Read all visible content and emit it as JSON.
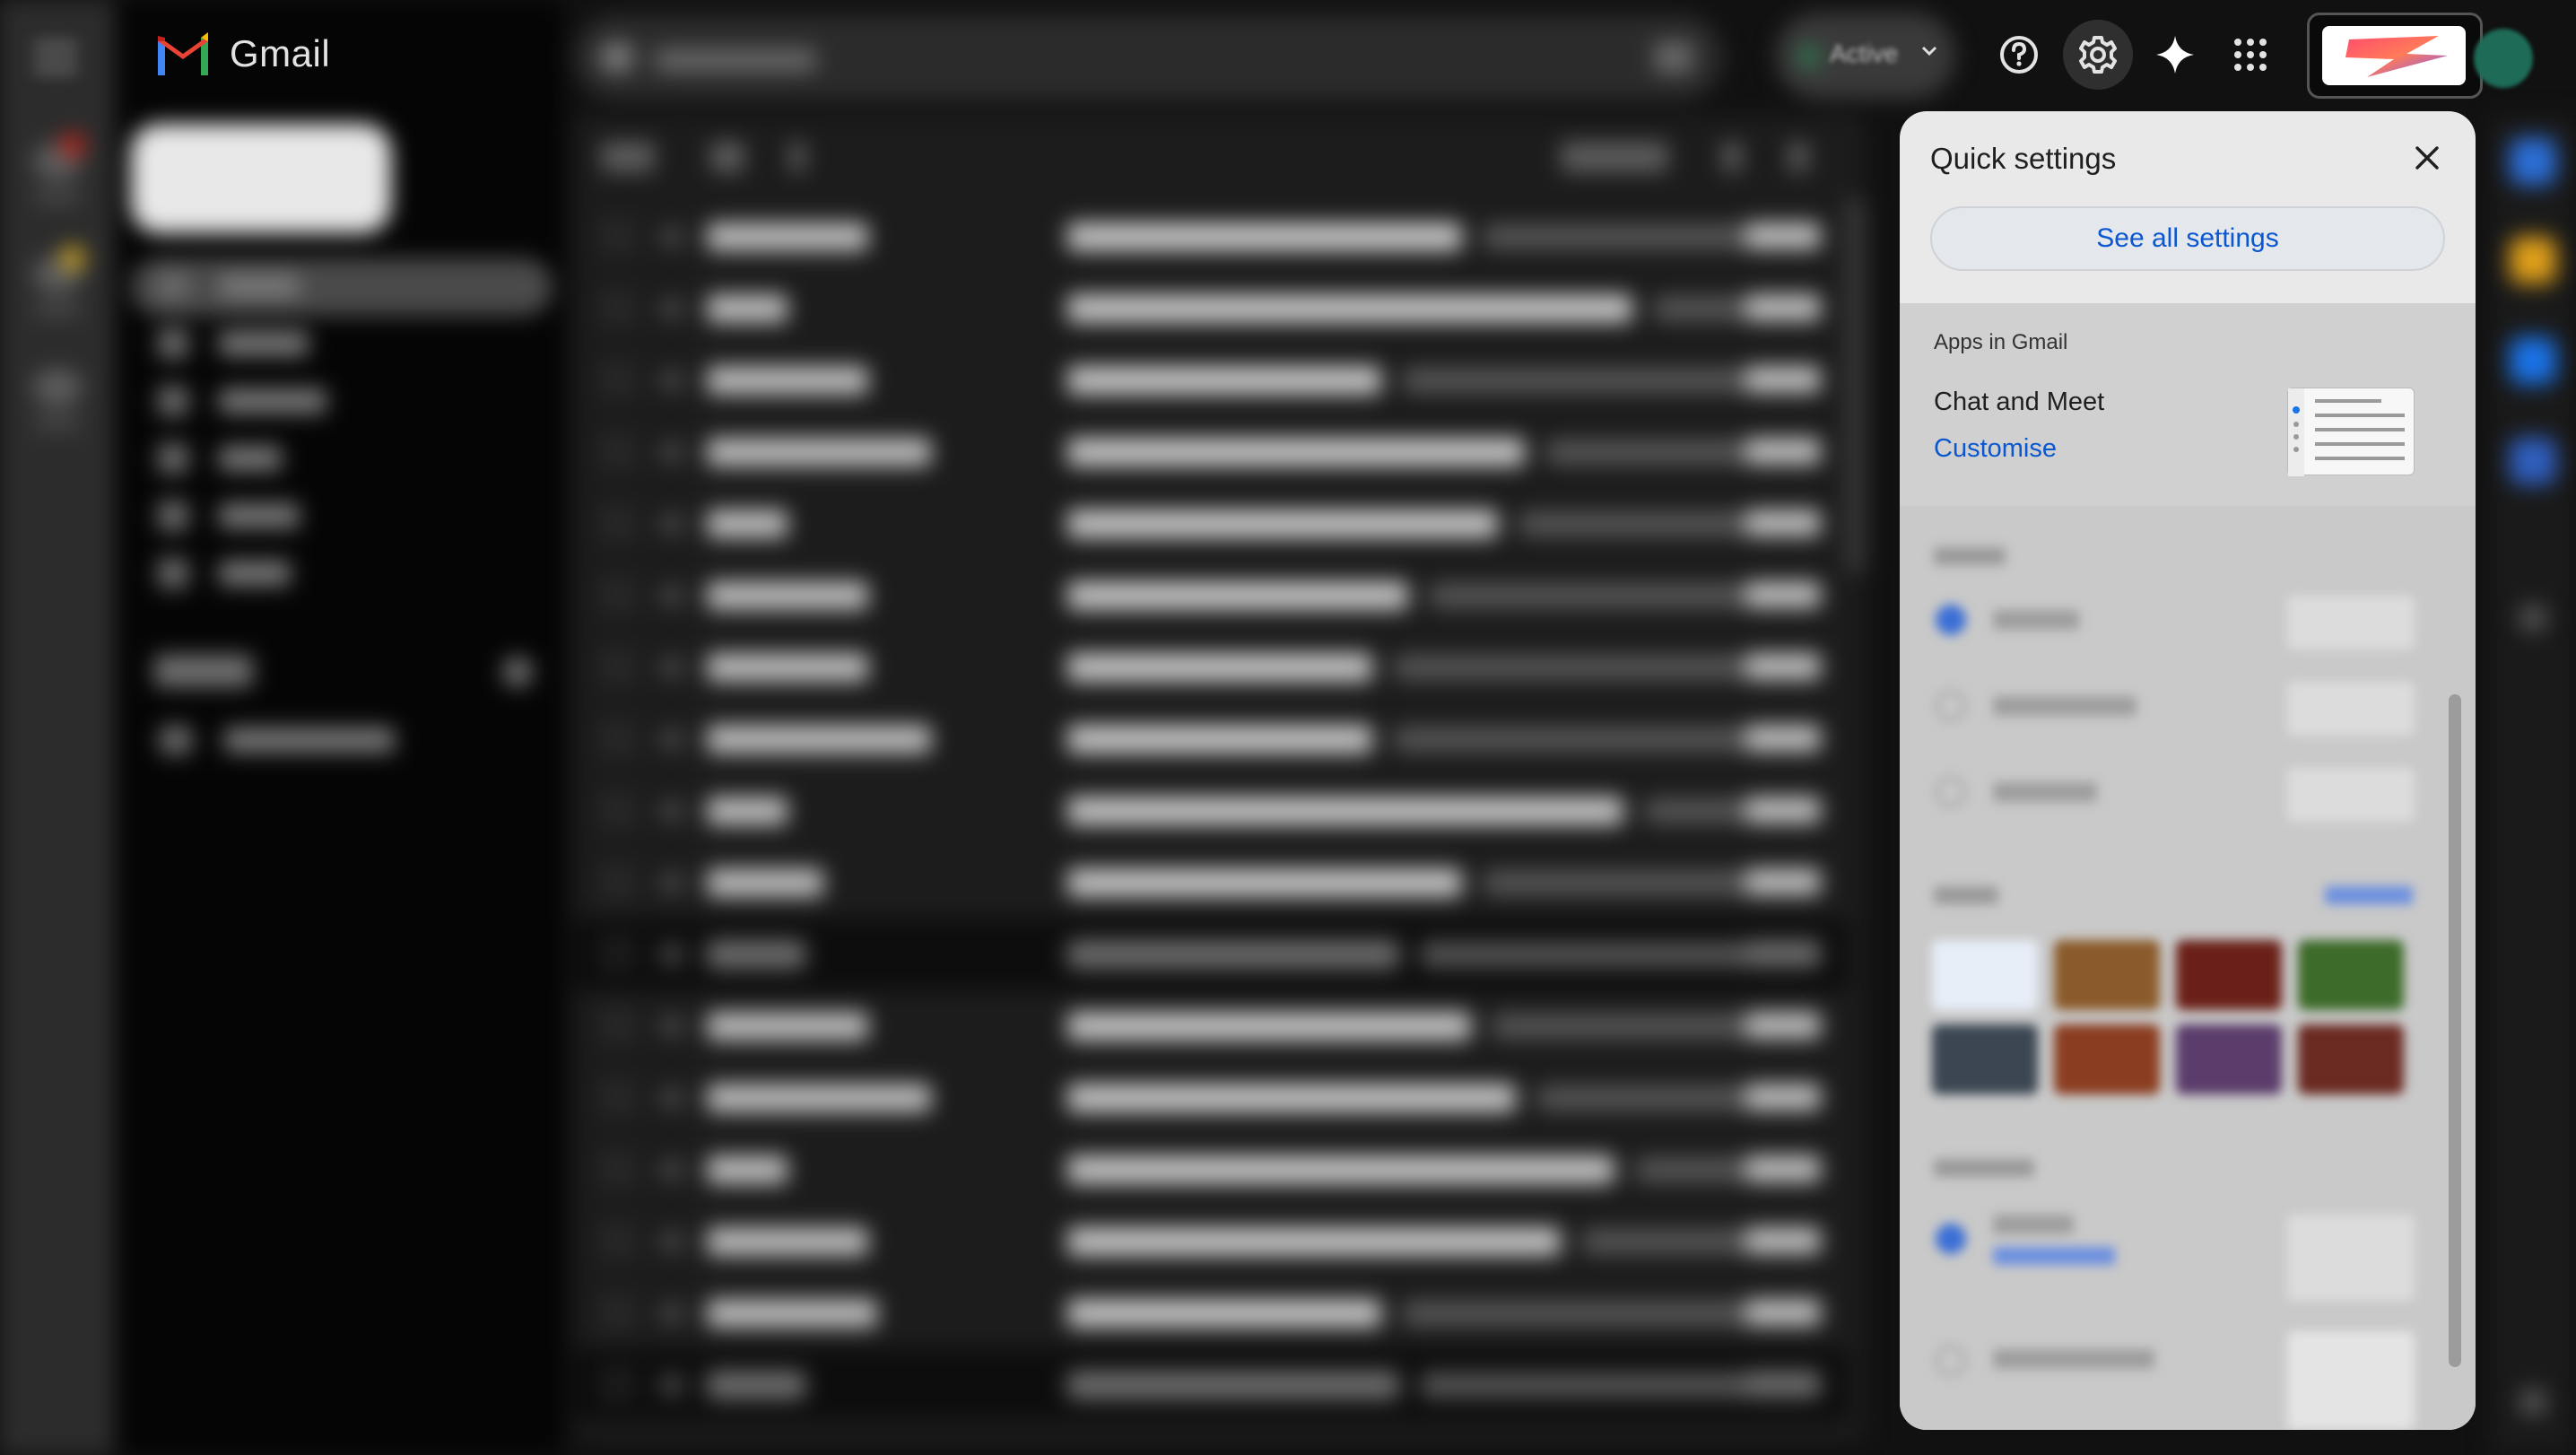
{
  "app": {
    "name": "Gmail"
  },
  "header": {
    "status_label": "Active",
    "icons": [
      "menu-icon",
      "help-icon",
      "settings-icon",
      "gemini-sparkle-icon",
      "apps-grid-icon",
      "account-logo",
      "avatar"
    ]
  },
  "quick_settings": {
    "title": "Quick settings",
    "see_all_label": "See all settings",
    "apps_section_title": "Apps in Gmail",
    "apps_item_label": "Chat and Meet",
    "customise_label": "Customise"
  },
  "colors": {
    "accent_blue": "#0b57d0",
    "panel_bg": "#e9e9ea",
    "apps_section_bg": "#d0d0d0",
    "dark_bg": "#111111"
  }
}
